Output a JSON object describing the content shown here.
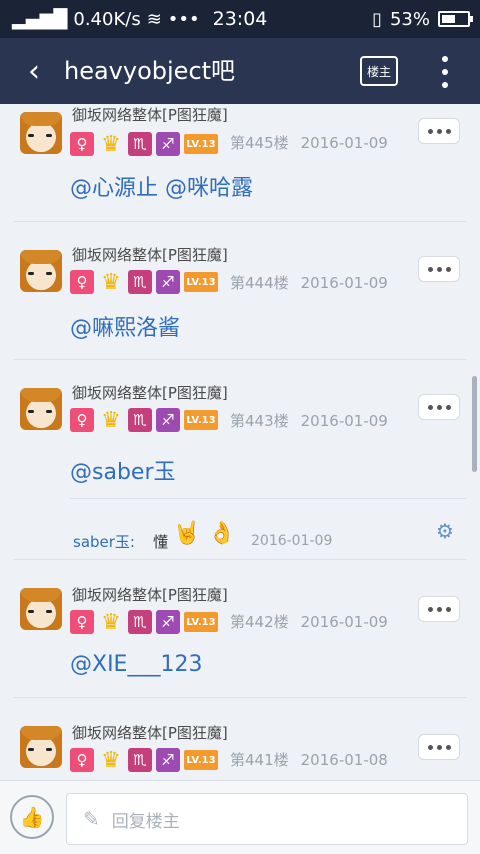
{
  "status": {
    "network_speed": "0.40K/s",
    "time": "23:04",
    "battery": "53%",
    "battery_level": 0.53
  },
  "nav": {
    "back_icon": "back-chevron-icon",
    "title": "heavyobject吧",
    "louzhu_label": "楼主",
    "more_icon": "more-vertical-icon"
  },
  "posts": [
    {
      "username": "御坂网络整体[P图狂魔]",
      "lv": "LV.13",
      "floor": "第445楼",
      "date": "2016-01-09",
      "text": "@心源止 @咪哈露"
    },
    {
      "username": "御坂网络整体[P图狂魔]",
      "lv": "LV.13",
      "floor": "第444楼",
      "date": "2016-01-09",
      "text": "@嘛熙洛酱"
    },
    {
      "username": "御坂网络整体[P图狂魔]",
      "lv": "LV.13",
      "floor": "第443楼",
      "date": "2016-01-09",
      "text": "@saber玉",
      "reply": {
        "user": "saber玉:",
        "text": "懂",
        "date": "2016-01-09"
      }
    },
    {
      "username": "御坂网络整体[P图狂魔]",
      "lv": "LV.13",
      "floor": "第442楼",
      "date": "2016-01-09",
      "text": "@XIE___123"
    },
    {
      "username": "御坂网络整体[P图狂魔]",
      "lv": "LV.13",
      "floor": "第441楼",
      "date": "2016-01-08",
      "text": ""
    }
  ],
  "badges": {
    "female": "♀",
    "crown": "♛",
    "scorpio": "♏",
    "sagittarius": "♐"
  },
  "bottom": {
    "reply_placeholder": "回复楼主",
    "like_icon": "thumbs-up-icon"
  }
}
